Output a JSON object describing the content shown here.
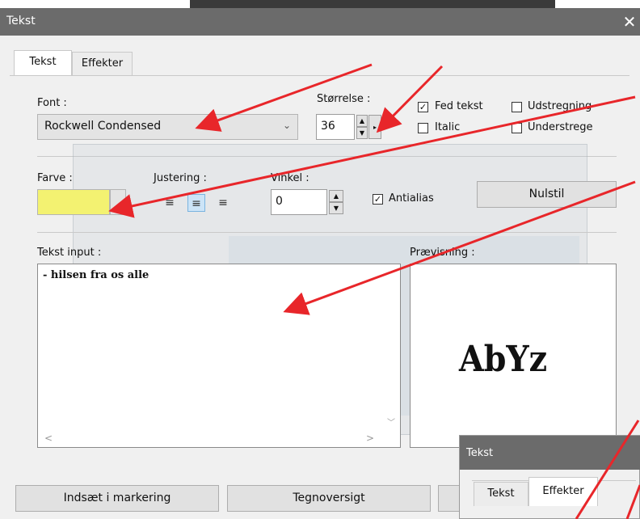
{
  "window": {
    "title": "Tekst",
    "close_icon": "close-icon"
  },
  "tabs": [
    {
      "label": "Tekst",
      "active": true
    },
    {
      "label": "Effekter",
      "active": false
    }
  ],
  "font": {
    "label": "Font :",
    "value": "Rockwell Condensed"
  },
  "size": {
    "label": "Størrelse :",
    "value": "36"
  },
  "checkboxes": {
    "bold": {
      "label": "Fed tekst",
      "checked": true
    },
    "italic": {
      "label": "Italic",
      "checked": false
    },
    "strike": {
      "label": "Udstregning",
      "checked": false
    },
    "underline": {
      "label": "Understrege",
      "checked": false
    },
    "antialias": {
      "label": "Antialias",
      "checked": true
    }
  },
  "color": {
    "label": "Farve :",
    "value": "#f3f271"
  },
  "alignment": {
    "label": "Justering :",
    "selected": "center"
  },
  "angle": {
    "label": "Vinkel :",
    "value": "0"
  },
  "reset_label": "Nulstil",
  "text_input": {
    "label": "Tekst input :",
    "value": "- hilsen fra os alle"
  },
  "preview": {
    "label": "Prævisning :",
    "sample": "AbYz"
  },
  "buttons": {
    "insert": "Indsæt i markering",
    "charmap": "Tegnoversigt"
  },
  "inset": {
    "title": "Tekst",
    "tabs": [
      "Tekst",
      "Effekter"
    ]
  },
  "annotation_color": "#e8262a"
}
